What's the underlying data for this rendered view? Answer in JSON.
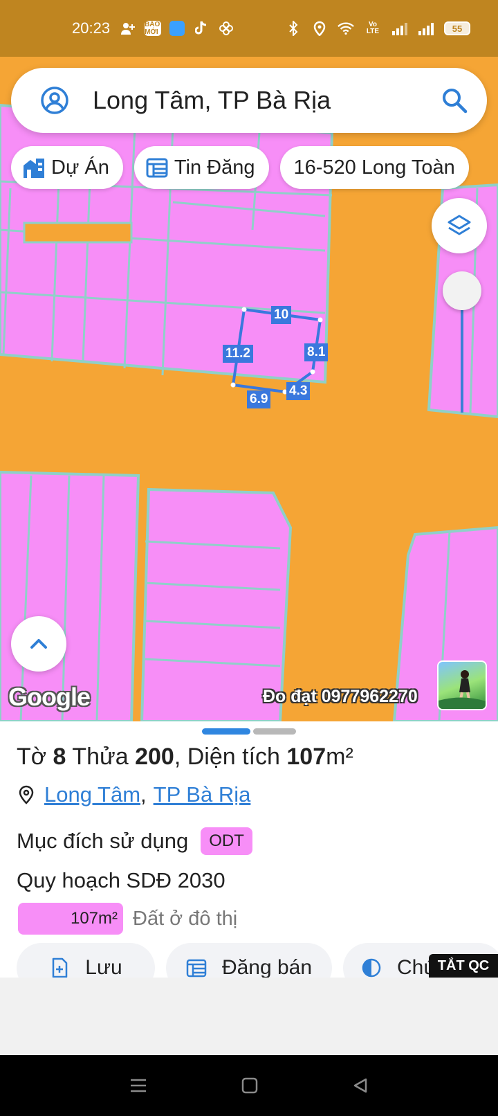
{
  "status_bar": {
    "time": "20:23",
    "left_icons": [
      "add-contact-icon",
      "baomoi-icon",
      "app-icon",
      "tiktok-icon",
      "pinwheel-icon"
    ],
    "right_icons": [
      "bluetooth-icon",
      "location-icon",
      "wifi-icon",
      "volte-icon",
      "signal-icon",
      "signal-icon"
    ],
    "battery": "55",
    "baomoi_label": "BÁO MỚI",
    "volte_label": "Vo LTE"
  },
  "search": {
    "text": "Long Tâm, TP Bà Rịa",
    "left_icon": "user-icon",
    "right_icon": "search-icon"
  },
  "chips": [
    {
      "label": "Dự Án",
      "icon": "building-icon"
    },
    {
      "label": "Tin Đăng",
      "icon": "listing-icon"
    },
    {
      "label": "16-520 Long Toàn"
    }
  ],
  "map": {
    "dimensions": [
      "10",
      "11.2",
      "8.1",
      "4.3",
      "6.9"
    ],
    "logo": "Google",
    "watermark": "Đo đạt 0977962270",
    "colors": {
      "road": "#f5a535",
      "residential": "#f78ef7",
      "parcel_border": "#3a78dd",
      "lot_line": "#8fd0c8"
    }
  },
  "parcel": {
    "sheet_prefix": "Tờ",
    "sheet_no": "8",
    "parcel_prefix": "Thửa",
    "parcel_no": "200",
    "area_prefix": "Diện tích",
    "area_value": "107",
    "area_unit": "m²",
    "ward": "Long Tâm",
    "city": "TP Bà Rịa",
    "purpose_label": "Mục đích sử dụng",
    "purpose_code": "ODT",
    "plan_title": "Quy hoạch SDĐ 2030",
    "plan_area": "107m²",
    "plan_desc": "Đất ở đô thị"
  },
  "actions": [
    {
      "label": "Lưu",
      "icon": "save-file-icon"
    },
    {
      "label": "Đăng bán",
      "icon": "listing-icon"
    },
    {
      "label": "Chú thích",
      "icon": "legend-icon"
    }
  ],
  "ad_off": "TẮT QC",
  "accent": "#2f7fd6"
}
